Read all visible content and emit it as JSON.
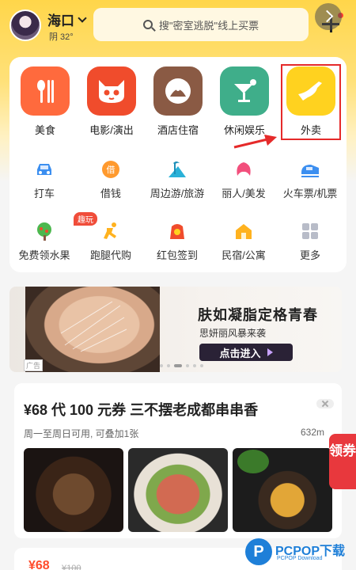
{
  "header": {
    "city": "海口",
    "weather": "阴 32°",
    "search_placeholder": "搜\"密室逃脱\"线上买票"
  },
  "main_categories": [
    {
      "label": "美食",
      "icon": "fork-knife-icon",
      "color": "#ff6a3d"
    },
    {
      "label": "电影/演出",
      "icon": "cat-icon",
      "color": "#f04c2c"
    },
    {
      "label": "酒店住宿",
      "icon": "hotel-icon",
      "color": "#8a5a44"
    },
    {
      "label": "休闲娱乐",
      "icon": "cocktail-icon",
      "color": "#3fae8a"
    },
    {
      "label": "外卖",
      "icon": "kangaroo-icon",
      "color": "#ffd21f"
    }
  ],
  "sub_row1": [
    {
      "label": "打车",
      "icon": "car-icon"
    },
    {
      "label": "借钱",
      "icon": "loan-icon"
    },
    {
      "label": "周边游/旅游",
      "icon": "palm-tree-icon"
    },
    {
      "label": "丽人/美发",
      "icon": "hair-icon"
    },
    {
      "label": "火车票/机票",
      "icon": "train-icon"
    }
  ],
  "sub_row2": [
    {
      "label": "免费领水果",
      "icon": "tree-icon",
      "badge": "趣玩"
    },
    {
      "label": "跑腿代购",
      "icon": "runner-icon"
    },
    {
      "label": "红包签到",
      "icon": "red-envelope-icon"
    },
    {
      "label": "民宿/公寓",
      "icon": "house-icon"
    },
    {
      "label": "更多",
      "icon": "grid-icon"
    }
  ],
  "banner": {
    "title": "肤如凝脂定格青春",
    "subtitle": "思妍丽风暴来袭",
    "button": "点击进入",
    "ad_tag": "广告"
  },
  "deal": {
    "title": "¥68 代 100 元券 三不摆老成都串串香",
    "desc": "周一至周日可用, 可叠加1张",
    "distance": "632m"
  },
  "coupon_tag": "领券",
  "bottom": {
    "price": "¥68",
    "old_price": "¥100"
  },
  "watermark": {
    "text": "PCPOP下载",
    "sub": "PCPOP Download"
  },
  "colors": {
    "accent": "#ffd64a",
    "highlight": "#e52a2a"
  }
}
